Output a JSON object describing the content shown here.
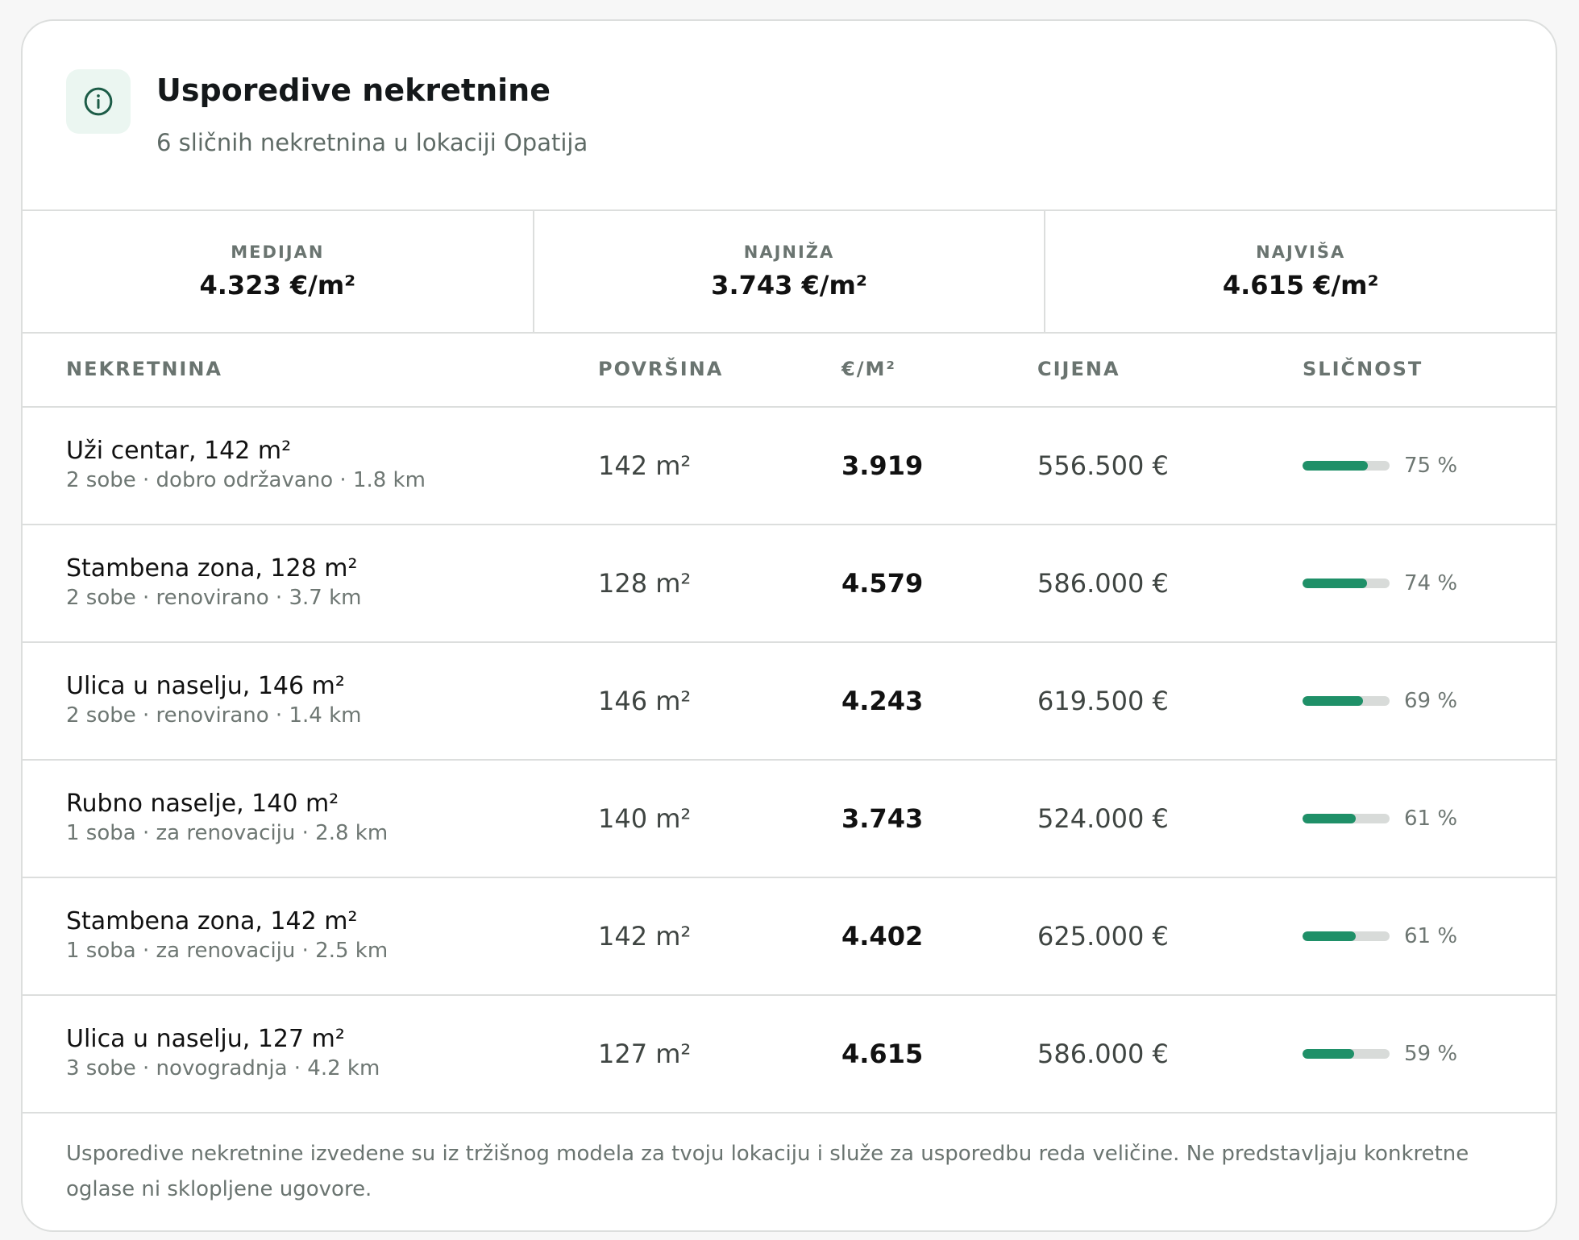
{
  "header": {
    "icon": "info-icon",
    "title": "Usporedive nekretnine",
    "subtitle": "6 sličnih nekretnina u lokaciji Opatija"
  },
  "stats": [
    {
      "label": "MEDIJAN",
      "value": "4.323 €/m²"
    },
    {
      "label": "NAJNIŽA",
      "value": "3.743 €/m²"
    },
    {
      "label": "NAJVIŠA",
      "value": "4.615 €/m²"
    }
  ],
  "table": {
    "headers": {
      "property": "NEKRETNINA",
      "area": "POVRŠINA",
      "price_per_m2": "€/M²",
      "price": "CIJENA",
      "similarity": "SLIČNOST"
    },
    "rows": [
      {
        "name": "Uži centar, 142 m²",
        "meta": "2 sobe · dobro održavano · 1.8 km",
        "area": "142 m²",
        "ppm": "3.919",
        "price": "556.500 €",
        "similarity_text": "75 %",
        "similarity": 75
      },
      {
        "name": "Stambena zona, 128 m²",
        "meta": "2 sobe · renovirano · 3.7 km",
        "area": "128 m²",
        "ppm": "4.579",
        "price": "586.000 €",
        "similarity_text": "74 %",
        "similarity": 74
      },
      {
        "name": "Ulica u naselju, 146 m²",
        "meta": "2 sobe · renovirano · 1.4 km",
        "area": "146 m²",
        "ppm": "4.243",
        "price": "619.500 €",
        "similarity_text": "69 %",
        "similarity": 69
      },
      {
        "name": "Rubno naselje, 140 m²",
        "meta": "1 soba · za renovaciju · 2.8 km",
        "area": "140 m²",
        "ppm": "3.743",
        "price": "524.000 €",
        "similarity_text": "61 %",
        "similarity": 61
      },
      {
        "name": "Stambena zona, 142 m²",
        "meta": "1 soba · za renovaciju · 2.5 km",
        "area": "142 m²",
        "ppm": "4.402",
        "price": "625.000 €",
        "similarity_text": "61 %",
        "similarity": 61
      },
      {
        "name": "Ulica u naselju, 127 m²",
        "meta": "3 sobe · novogradnja · 4.2 km",
        "area": "127 m²",
        "ppm": "4.615",
        "price": "586.000 €",
        "similarity_text": "59 %",
        "similarity": 59
      }
    ]
  },
  "footer": {
    "note": "Usporedive nekretnine izvedene su iz tržišnog modela za tvoju lokaciju i služe za usporedbu reda veličine. Ne predstavljaju konkretne oglase ni sklopljene ugovore."
  },
  "colors": {
    "accent": "#1f9068",
    "icon_bg": "#ebf6f1",
    "icon_stroke": "#1c5c47",
    "border": "#dcdedd"
  }
}
